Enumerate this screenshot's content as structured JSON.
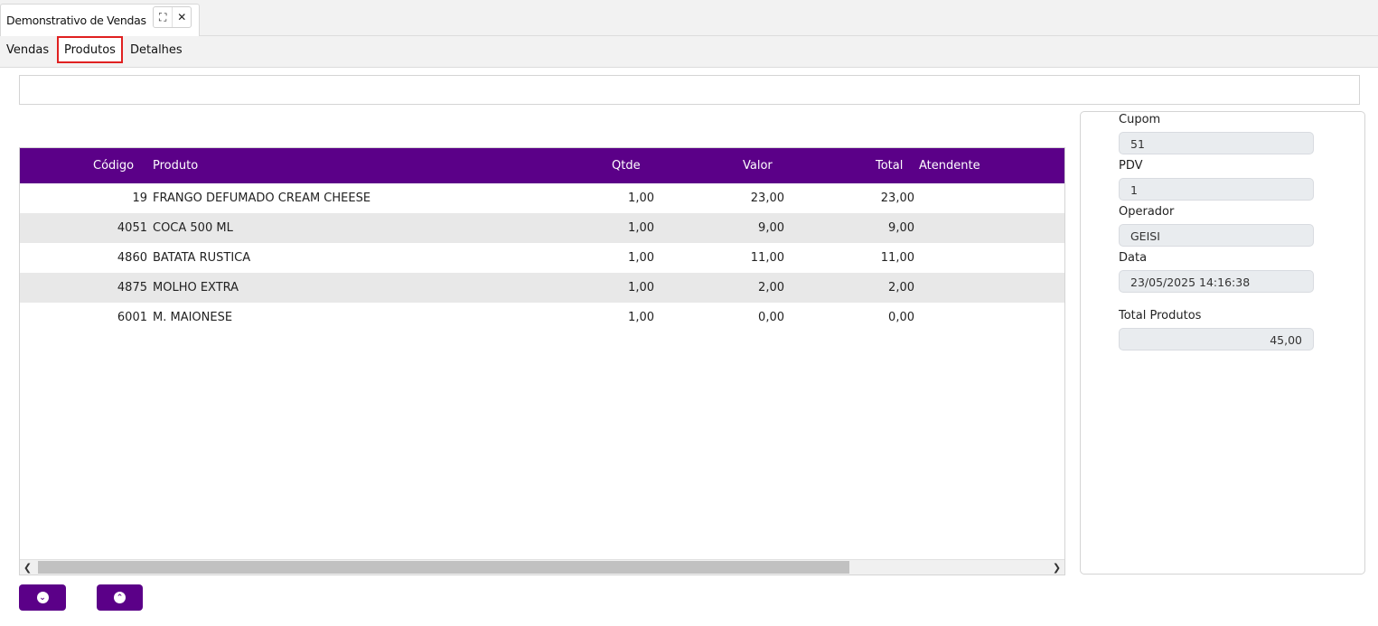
{
  "window": {
    "title": "Demonstrativo de Vendas",
    "maximize_icon": "⛶",
    "close_icon": "✕"
  },
  "tabs": [
    {
      "label": "Vendas"
    },
    {
      "label": "Produtos",
      "active": true
    },
    {
      "label": "Detalhes"
    }
  ],
  "filter": {
    "value": ""
  },
  "table": {
    "columns": [
      "Código",
      "Produto",
      "Qtde",
      "Valor",
      "Total",
      "Atendente"
    ],
    "rows": [
      {
        "codigo": "19",
        "produto": "FRANGO DEFUMADO CREAM CHEESE",
        "qtde": "1,00",
        "valor": "23,00",
        "total": "23,00",
        "atendente": ""
      },
      {
        "codigo": "4051",
        "produto": "COCA 500 ML",
        "qtde": "1,00",
        "valor": "9,00",
        "total": "9,00",
        "atendente": ""
      },
      {
        "codigo": "4860",
        "produto": "BATATA RUSTICA",
        "qtde": "1,00",
        "valor": "11,00",
        "total": "11,00",
        "atendente": ""
      },
      {
        "codigo": "4875",
        "produto": "MOLHO EXTRA",
        "qtde": "1,00",
        "valor": "2,00",
        "total": "2,00",
        "atendente": ""
      },
      {
        "codigo": "6001",
        "produto": "M. MAIONESE",
        "qtde": "1,00",
        "valor": "0,00",
        "total": "0,00",
        "atendente": ""
      }
    ]
  },
  "details": {
    "cupom_label": "Cupom",
    "cupom": "51",
    "pdv_label": "PDV",
    "pdv": "1",
    "operador_label": "Operador",
    "operador": "GEISI",
    "data_label": "Data",
    "data": "23/05/2025 14:16:38",
    "total_label": "Total Produtos",
    "total": "45,00"
  },
  "colors": {
    "accent": "#5b0088",
    "active_tab_border": "#e02020"
  }
}
